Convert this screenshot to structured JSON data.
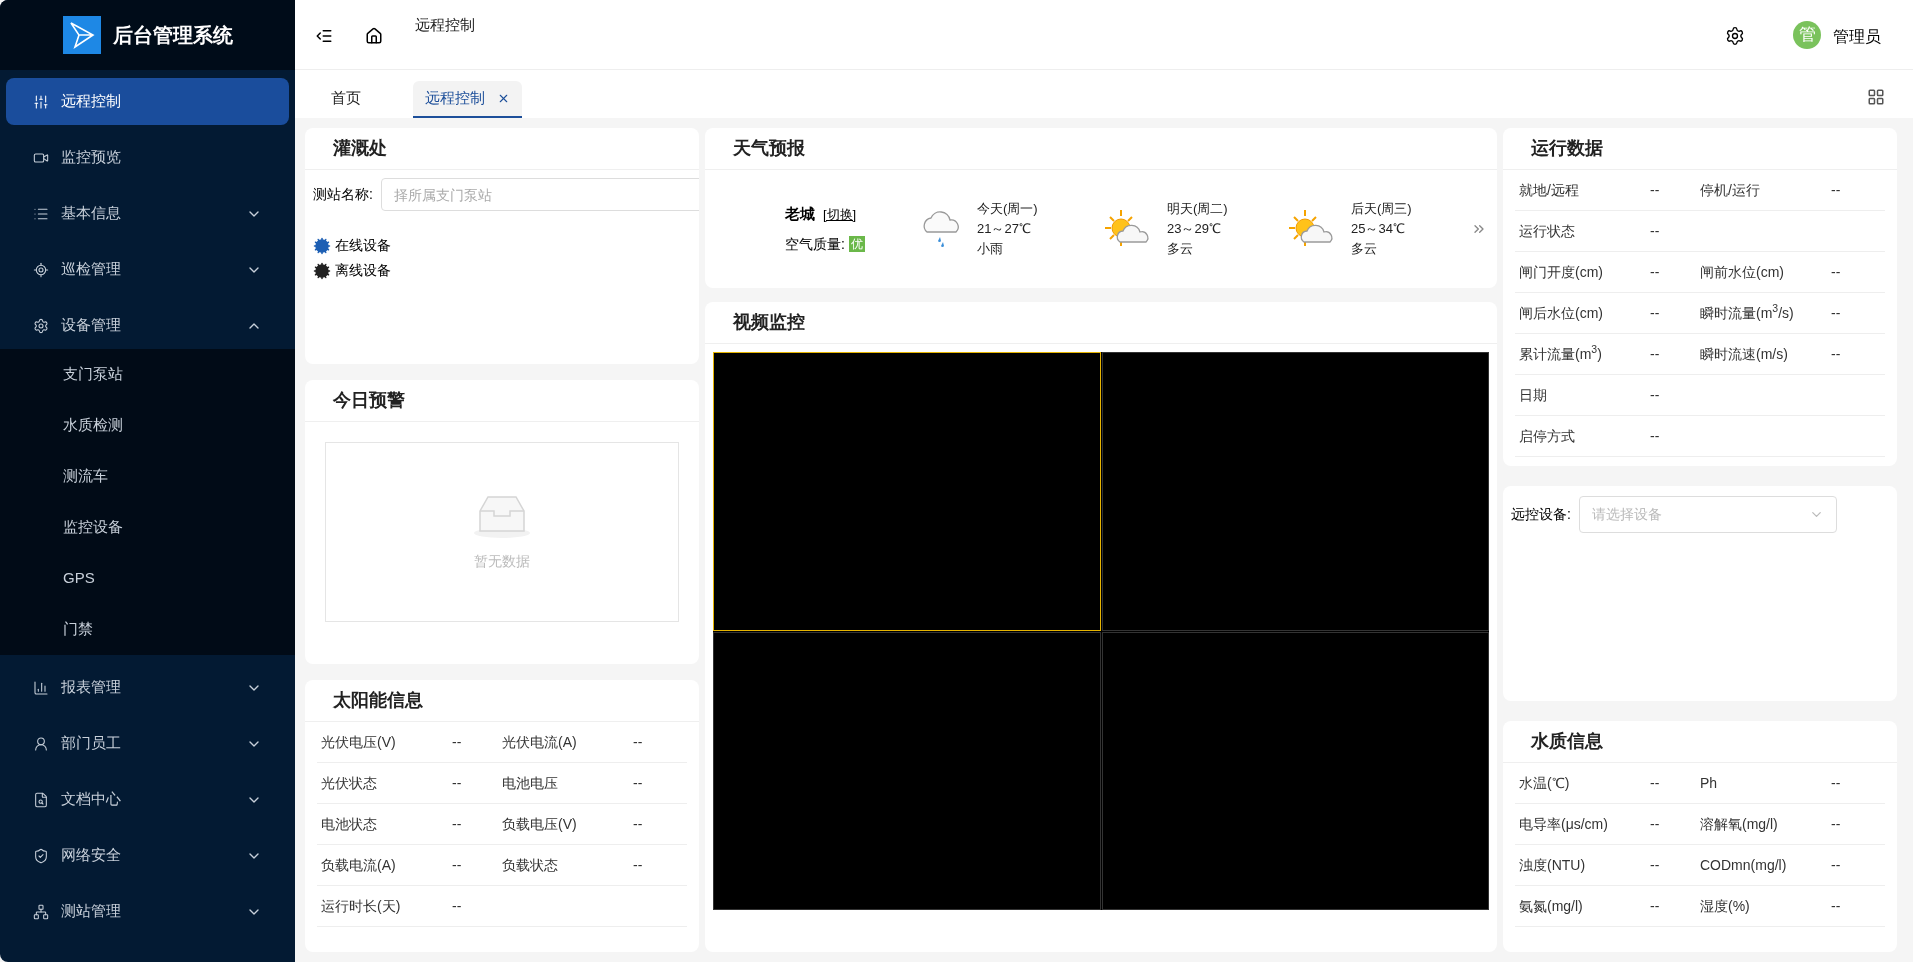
{
  "sidebar": {
    "title": "后台管理系统",
    "items": [
      {
        "label": "远程控制",
        "selected": true
      },
      {
        "label": "监控预览",
        "selected": false
      },
      {
        "label": "基本信息",
        "selected": false,
        "expanded": false
      },
      {
        "label": "巡检管理",
        "selected": false,
        "expanded": false
      },
      {
        "label": "设备管理",
        "selected": false,
        "expanded": true,
        "children": [
          {
            "label": "支门泵站",
            "selected": false
          },
          {
            "label": "水质检测",
            "selected": false
          },
          {
            "label": "测流车",
            "selected": false
          },
          {
            "label": "监控设备",
            "selected": false
          },
          {
            "label": "GPS",
            "selected": false
          },
          {
            "label": "门禁",
            "selected": false
          }
        ]
      },
      {
        "label": "报表管理",
        "selected": false,
        "expanded": false
      },
      {
        "label": "部门员工",
        "selected": false,
        "expanded": false
      },
      {
        "label": "文档中心",
        "selected": false,
        "expanded": false
      },
      {
        "label": "网络安全",
        "selected": false,
        "expanded": false
      },
      {
        "label": "测站管理",
        "selected": false,
        "expanded": false
      }
    ]
  },
  "header": {
    "breadcrumb": "远程控制",
    "user": {
      "avatar": "管",
      "name": "管理员"
    }
  },
  "tabs": [
    {
      "label": "首页",
      "selected": false
    },
    {
      "label": "远程控制",
      "selected": true
    }
  ],
  "irrigation": {
    "title": "灌溉处",
    "station_label": "测站名称:",
    "station_placeholder": "择所属支门泵站",
    "legend": [
      {
        "label": "在线设备",
        "color": "#1d5fb4"
      },
      {
        "label": "离线设备",
        "color": "#222222"
      }
    ]
  },
  "alerts": {
    "title": "今日预警",
    "empty_text": "暂无数据"
  },
  "solar": {
    "title": "太阳能信息",
    "rows": [
      [
        {
          "label": "光伏电压(V)",
          "value": "--"
        },
        {
          "label": "光伏电流(A)",
          "value": "--"
        }
      ],
      [
        {
          "label": "光伏状态",
          "value": "--"
        },
        {
          "label": "电池电压",
          "value": "--"
        }
      ],
      [
        {
          "label": "电池状态",
          "value": "--"
        },
        {
          "label": "负载电压(V)",
          "value": "--"
        }
      ],
      [
        {
          "label": "负载电流(A)",
          "value": "--"
        },
        {
          "label": "负载状态",
          "value": "--"
        }
      ],
      [
        {
          "label": "运行时长(天)",
          "value": "--"
        }
      ]
    ]
  },
  "weather": {
    "title": "天气预报",
    "city": "老城",
    "switch_link": "[切换]",
    "air_label": "空气质量:",
    "air_value": "优",
    "days": [
      {
        "day": "今天(周一)",
        "temp": "21～27℃",
        "condition": "小雨",
        "kind": "rain"
      },
      {
        "day": "明天(周二)",
        "temp": "23～29℃",
        "condition": "多云",
        "kind": "cloudy"
      },
      {
        "day": "后天(周三)",
        "temp": "25～34℃",
        "condition": "多云",
        "kind": "cloudy"
      }
    ]
  },
  "video": {
    "title": "视频监控",
    "cells": [
      {
        "selected": true
      },
      {
        "selected": false
      },
      {
        "selected": false
      },
      {
        "selected": false
      }
    ]
  },
  "run_data": {
    "title": "运行数据",
    "rows": [
      [
        {
          "label": "就地/远程",
          "value": "--"
        },
        {
          "label": "停机/运行",
          "value": "--"
        }
      ],
      [
        {
          "label": "运行状态",
          "value": "--"
        }
      ],
      [
        {
          "label": "闸门开度(cm)",
          "value": "--"
        },
        {
          "label": "闸前水位(cm)",
          "value": "--"
        }
      ],
      [
        {
          "label": "闸后水位(cm)",
          "value": "--"
        },
        {
          "label": "瞬时流量(m$^{3}$/s)",
          "value": "--"
        }
      ],
      [
        {
          "label": "累计流量(m$^{3}$)",
          "value": "--"
        },
        {
          "label": "瞬时流速(m/s)",
          "value": "--"
        }
      ],
      [
        {
          "label": "日期",
          "value": "--"
        }
      ],
      [
        {
          "label": "启停方式",
          "value": "--"
        }
      ]
    ]
  },
  "remote": {
    "label": "远控设备:",
    "placeholder": "请选择设备"
  },
  "water_quality": {
    "title": "水质信息",
    "rows": [
      [
        {
          "label": "水温(℃)",
          "value": "--"
        },
        {
          "label": "Ph",
          "value": "--"
        }
      ],
      [
        {
          "label": "电导率(μs/cm)",
          "value": "--"
        },
        {
          "label": "溶解氧(mg/l)",
          "value": "--"
        }
      ],
      [
        {
          "label": "浊度(NTU)",
          "value": "--"
        },
        {
          "label": "CODmn(mg/l)",
          "value": "--"
        }
      ],
      [
        {
          "label": "氨氮(mg/l)",
          "value": "--"
        },
        {
          "label": "湿度(%)",
          "value": "--"
        }
      ]
    ]
  }
}
